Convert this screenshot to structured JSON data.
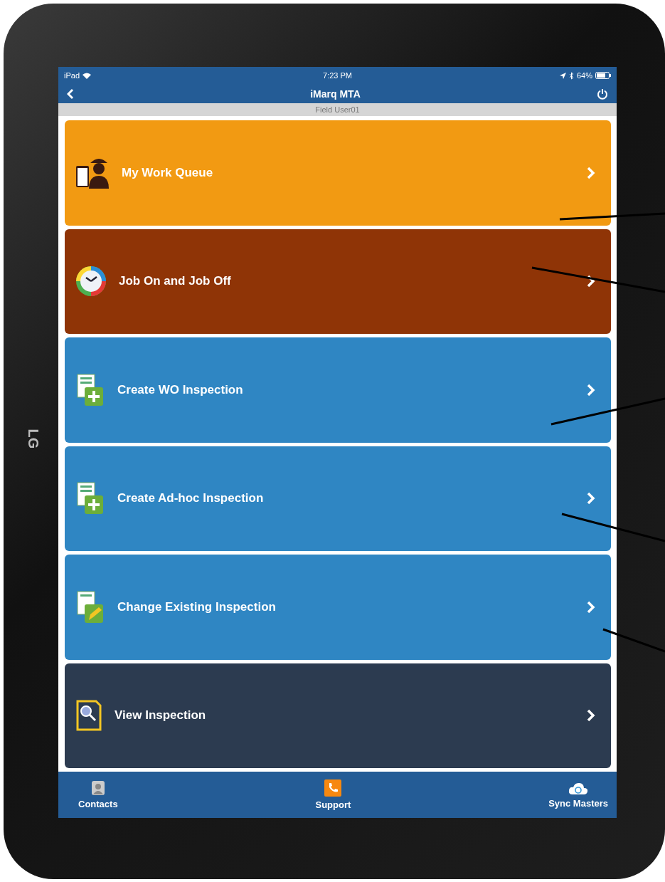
{
  "device": {
    "brand": "LG"
  },
  "status_bar": {
    "carrier": "iPad",
    "time": "7:23 PM",
    "battery": "64%"
  },
  "nav_bar": {
    "title": "iMarq MTA"
  },
  "user_bar": {
    "user": "Field User01"
  },
  "menu": [
    {
      "label": "My Work Queue",
      "kind": "worker",
      "color": "#f29a12"
    },
    {
      "label": "Job On and Job Off",
      "kind": "clock",
      "color": "#8f3406"
    },
    {
      "label": "Create WO Inspection",
      "kind": "add-doc",
      "color": "#2f86c3"
    },
    {
      "label": "Create Ad-hoc Inspection",
      "kind": "add-doc",
      "color": "#2f86c3"
    },
    {
      "label": "Change Existing Inspection",
      "kind": "edit-doc",
      "color": "#2f86c3"
    },
    {
      "label": "View Inspection",
      "kind": "search-doc",
      "color": "#2c3b50"
    }
  ],
  "tab_bar": [
    {
      "label": "Contacts",
      "kind": "contacts"
    },
    {
      "label": "Support",
      "kind": "phone"
    },
    {
      "label": "Sync Masters",
      "kind": "sync"
    }
  ]
}
